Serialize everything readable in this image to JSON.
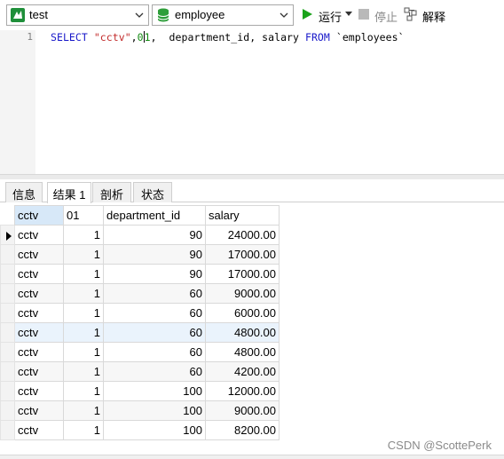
{
  "toolbar": {
    "connection": "test",
    "database": "employee",
    "run_label": "运行",
    "stop_label": "停止",
    "explain_label": "解释"
  },
  "editor": {
    "line_number": "1",
    "kw_select": "SELECT",
    "str_value": "\"cctv\"",
    "comma1": ",",
    "num_before_caret": "0",
    "num_after_caret": "1",
    "columns_rest": ",  department_id, salary ",
    "kw_from": "FROM",
    "table_ref": " `employees`"
  },
  "tabs": {
    "info": "信息",
    "result": "结果 1",
    "profile": "剖析",
    "status": "状态"
  },
  "grid": {
    "headers": [
      "cctv",
      "01",
      "department_id",
      "salary"
    ],
    "rows": [
      [
        "cctv",
        "1",
        "90",
        "24000.00"
      ],
      [
        "cctv",
        "1",
        "90",
        "17000.00"
      ],
      [
        "cctv",
        "1",
        "90",
        "17000.00"
      ],
      [
        "cctv",
        "1",
        "60",
        "9000.00"
      ],
      [
        "cctv",
        "1",
        "60",
        "6000.00"
      ],
      [
        "cctv",
        "1",
        "60",
        "4800.00"
      ],
      [
        "cctv",
        "1",
        "60",
        "4800.00"
      ],
      [
        "cctv",
        "1",
        "60",
        "4200.00"
      ],
      [
        "cctv",
        "1",
        "100",
        "12000.00"
      ],
      [
        "cctv",
        "1",
        "100",
        "9000.00"
      ],
      [
        "cctv",
        "1",
        "100",
        "8200.00"
      ]
    ]
  },
  "watermark": "CSDN @ScottePerk",
  "colors": {
    "keyword": "#1717c9",
    "string": "#c22a2a",
    "number": "#138a13",
    "run_green": "#1aa31a",
    "db_green": "#2e9e3a",
    "header_selected": "#d7e8f8"
  },
  "icons": {
    "connection": "connection-icon",
    "database": "database-icon",
    "run": "play-icon",
    "stop": "stop-icon",
    "explain": "explain-icon"
  }
}
